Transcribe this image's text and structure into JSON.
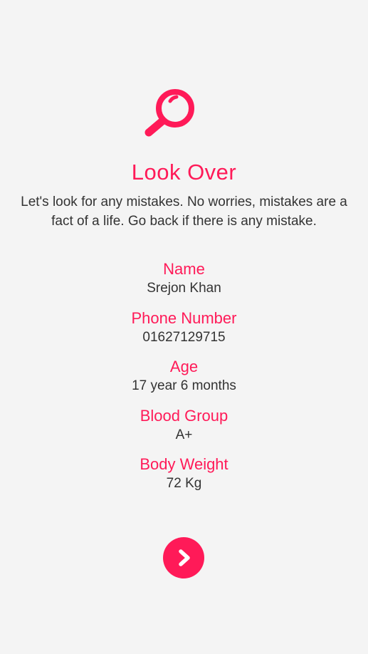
{
  "colors": {
    "accent": "#ff1a58",
    "text": "#333333",
    "background": "#f4f4f4"
  },
  "header": {
    "icon": "magnifier-icon",
    "title": "Look Over",
    "description": "Let's look for any mistakes. No worries, mistakes are a fact of a life. Go back if there is any mistake."
  },
  "details": [
    {
      "label": "Name",
      "value": "Srejon Khan"
    },
    {
      "label": "Phone Number",
      "value": "01627129715"
    },
    {
      "label": "Age",
      "value": "17 year 6 months"
    },
    {
      "label": "Blood Group",
      "value": "A+"
    },
    {
      "label": "Body Weight",
      "value": "72 Kg"
    }
  ],
  "next_button": {
    "icon": "chevron-right-icon"
  }
}
